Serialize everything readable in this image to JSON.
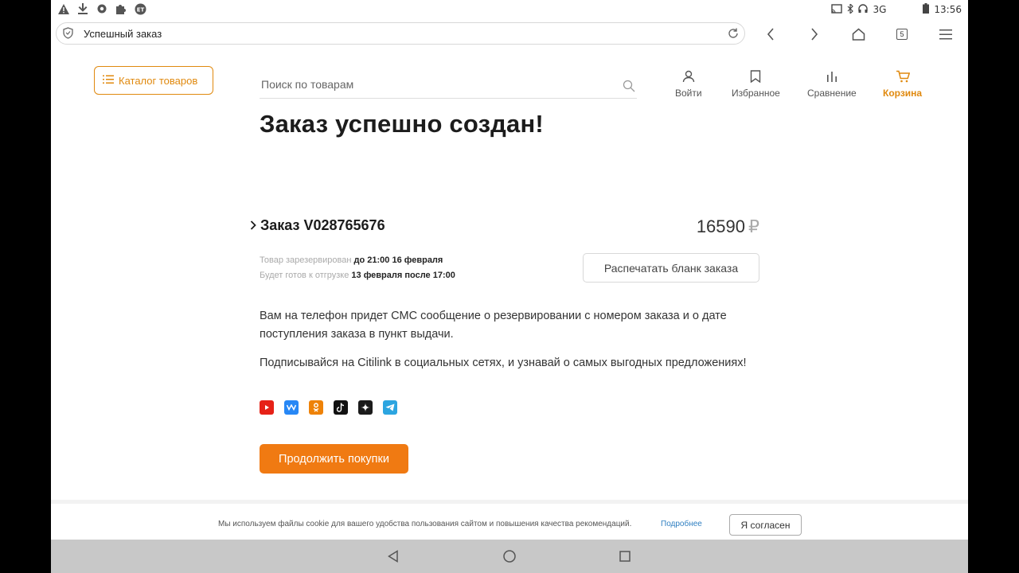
{
  "status_bar": {
    "network": "3G",
    "time": "13:56",
    "left_icons": [
      "warning-icon",
      "download-icon",
      "vpn-icon",
      "puzzle-icon",
      "et-icon"
    ],
    "et_label": "ET"
  },
  "browser": {
    "page_title": "Успешный заказ",
    "tab_count": "5"
  },
  "header": {
    "catalog_label": "Каталог товаров",
    "search_placeholder": "Поиск по товарам",
    "nav": [
      {
        "label": "Войти",
        "icon": "user-icon"
      },
      {
        "label": "Избранное",
        "icon": "bookmark-icon"
      },
      {
        "label": "Сравнение",
        "icon": "compare-icon"
      },
      {
        "label": "Корзина",
        "icon": "cart-icon",
        "active": true
      }
    ]
  },
  "main": {
    "title": "Заказ успешно создан!",
    "order": {
      "title": "Заказ V028765676",
      "price": "16590",
      "currency": "₽",
      "reserved_label": "Товар зарезервирован",
      "reserved_value": "до 21:00 16 февраля",
      "ready_label": "Будет готов к отгрузке",
      "ready_value": "13 февраля после 17:00",
      "print_label": "Распечатать бланк заказа"
    },
    "sms_text": "Вам на телефон придет СМС сообщение о резервировании с номером заказа и о дате поступления заказа в пункт выдачи.",
    "social_text": "Подписывайся на Citilink в социальных сетях, и узнавай о самых выгодных предложениях!",
    "socials": [
      {
        "name": "youtube",
        "color": "#e62117"
      },
      {
        "name": "vk",
        "color": "#2787f5"
      },
      {
        "name": "odnoklassniki",
        "color": "#ee8208"
      },
      {
        "name": "tiktok",
        "color": "#111111"
      },
      {
        "name": "dzen",
        "color": "#1b1b1b"
      },
      {
        "name": "telegram",
        "color": "#2ca5e0"
      }
    ],
    "continue_label": "Продолжить покупки"
  },
  "cookie": {
    "text": "Мы используем файлы cookie для вашего удобства пользования сайтом и повышения качества рекомендаций.",
    "link": "Подробнее",
    "accept": "Я согласен"
  },
  "colors": {
    "accent": "#f07a12",
    "accent_outline": "#e0890e"
  }
}
